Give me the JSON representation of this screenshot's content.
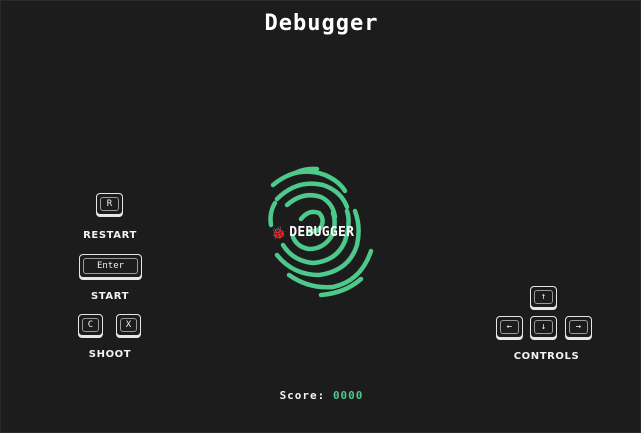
{
  "title": "Debugger",
  "logo": {
    "text": "DEBUGGER",
    "icon": "bug-icon",
    "ring_color": "#4ec98c"
  },
  "controls_left": {
    "restart": {
      "key": "R",
      "label": "RESTART"
    },
    "start": {
      "key": "Enter",
      "label": "START"
    },
    "shoot": {
      "keys": [
        "C",
        "X"
      ],
      "label": "SHOOT"
    }
  },
  "controls_right": {
    "keys": {
      "up": "↑",
      "left": "←",
      "down": "↓",
      "right": "→"
    },
    "label": "CONTROLS"
  },
  "score": {
    "label": "Score:",
    "value": "0000",
    "value_color": "#4ec98c"
  }
}
